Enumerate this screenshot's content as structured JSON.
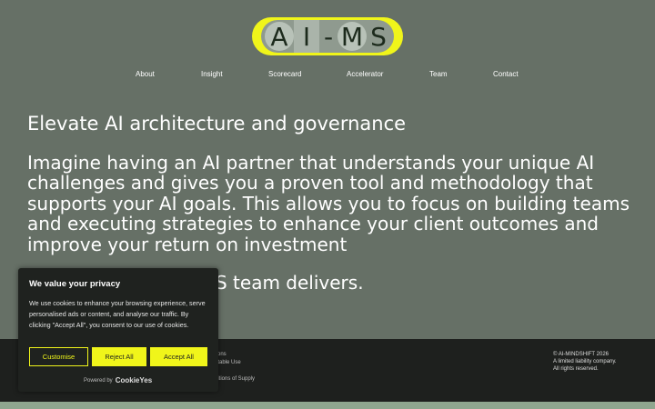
{
  "logo": {
    "chars": [
      "A",
      "I",
      "-",
      "M",
      "S"
    ]
  },
  "nav": {
    "items": [
      {
        "label": "About"
      },
      {
        "label": "Insight"
      },
      {
        "label": "Scorecard"
      },
      {
        "label": "Accelerator"
      },
      {
        "label": "Team"
      },
      {
        "label": "Contact"
      }
    ]
  },
  "main": {
    "heading": "Elevate AI architecture and governance",
    "paragraph": "Imagine having an AI partner that understands your unique AI challenges and gives you a proven tool and methodology that supports your AI goals. This allows you to focus on building teams and executing strategies to enhance your client outcomes and improve your return on investment",
    "delivers_visible": "S team delivers."
  },
  "footer": {
    "links": [
      "tions",
      "ptable Use",
      "ditions of Supply"
    ],
    "copyright": [
      "© AI-MINDSHIFT 2026",
      "A limited liability company.",
      "All rights reserved."
    ]
  },
  "cookie": {
    "title": "We value your privacy",
    "text": "We use cookies to enhance your browsing experience, serve personalised ads or content, and analyse our traffic. By clicking \"Accept All\", you consent to our use of cookies.",
    "customise_label": "Customise",
    "reject_label": "Reject All",
    "accept_label": "Accept All",
    "powered_by": "Powered by",
    "powered_brand": "CookieYes"
  },
  "colors": {
    "background": "#667066",
    "accent": "#f0f51a",
    "footer": "#1e201e",
    "banner": "#1f221f"
  }
}
